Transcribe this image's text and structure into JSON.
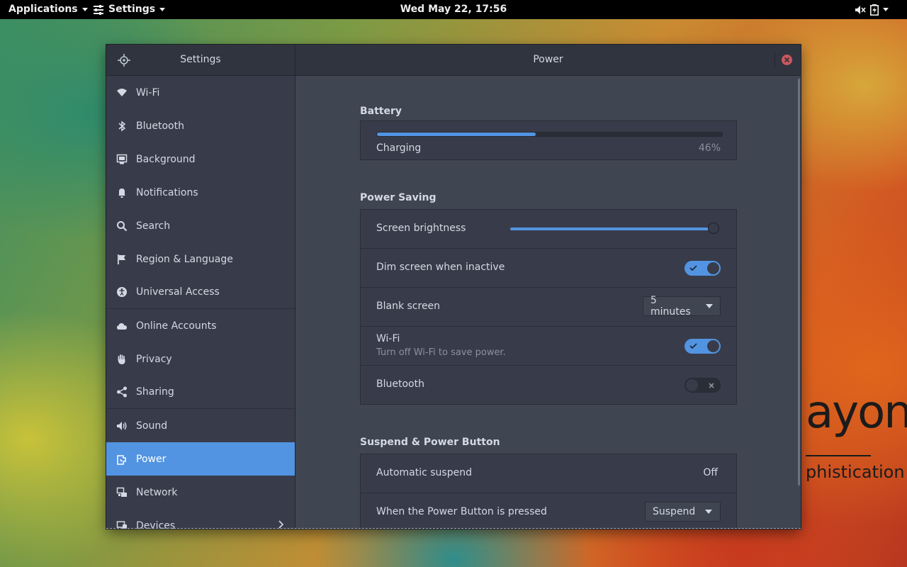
{
  "topbar": {
    "applications": "Applications",
    "settings": "Settings",
    "clock": "Wed May 22, 17:56"
  },
  "window": {
    "sidebar_title": "Settings",
    "page_title": "Power"
  },
  "sidebar": {
    "items": [
      {
        "label": "Wi-Fi",
        "icon": "wifi-icon"
      },
      {
        "label": "Bluetooth",
        "icon": "bluetooth-icon"
      },
      {
        "label": "Background",
        "icon": "background-icon"
      },
      {
        "label": "Notifications",
        "icon": "bell-icon"
      },
      {
        "label": "Search",
        "icon": "search-icon"
      },
      {
        "label": "Region & Language",
        "icon": "flag-icon"
      },
      {
        "label": "Universal Access",
        "icon": "accessibility-icon"
      },
      {
        "label": "Online Accounts",
        "icon": "cloud-icon"
      },
      {
        "label": "Privacy",
        "icon": "hand-icon"
      },
      {
        "label": "Sharing",
        "icon": "share-icon"
      },
      {
        "label": "Sound",
        "icon": "speaker-icon"
      },
      {
        "label": "Power",
        "icon": "power-icon",
        "active": true
      },
      {
        "label": "Network",
        "icon": "network-icon"
      },
      {
        "label": "Devices",
        "icon": "devices-icon"
      }
    ]
  },
  "battery": {
    "title": "Battery",
    "status": "Charging",
    "percent_label": "46%",
    "percent": 0.46
  },
  "power_saving": {
    "title": "Power Saving",
    "brightness_label": "Screen brightness",
    "brightness_level": 0.99,
    "dim_label": "Dim screen when inactive",
    "dim_on": true,
    "blank_label": "Blank screen",
    "blank_value": "5 minutes",
    "wifi_label": "Wi-Fi",
    "wifi_sub": "Turn off Wi-Fi to save power.",
    "wifi_on": true,
    "bluetooth_label": "Bluetooth",
    "bluetooth_on": false
  },
  "suspend": {
    "title": "Suspend & Power Button",
    "auto_label": "Automatic suspend",
    "auto_value": "Off",
    "button_label": "When the Power Button is pressed",
    "button_value": "Suspend"
  },
  "wallpaper": {
    "brand": "ayon",
    "tagline": "phistication"
  },
  "colors": {
    "accent": "#5294e2",
    "window_bg": "#353945",
    "content_bg": "#404552",
    "close": "#cc575d"
  }
}
